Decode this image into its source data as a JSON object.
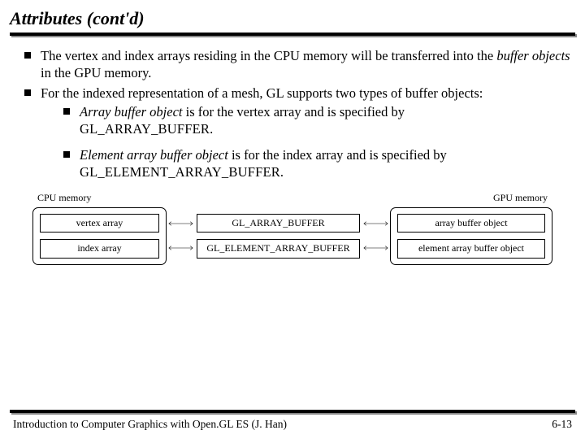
{
  "title": "Attributes (cont'd)",
  "bullets": {
    "b1_pre": "The vertex and index arrays residing in the CPU memory will be transferred into the ",
    "b1_ital": "buffer objects",
    "b1_post": " in the GPU memory.",
    "b2": "For the indexed representation of a mesh, GL supports two types of buffer objects:",
    "s1_ital": "Array buffer object",
    "s1_rest": " is for the vertex array and is specified by ",
    "s1_code": "GL_ARRAY_BUFFER.",
    "s2_ital": "Element array buffer object",
    "s2_rest": " is for the index array and is specified by ",
    "s2_code": "GL_ELEMENT_ARRAY_BUFFER."
  },
  "diagram": {
    "cpu_label": "CPU memory",
    "gpu_label": "GPU memory",
    "cpu_box1": "vertex array",
    "cpu_box2": "index array",
    "mid_box1": "GL_ARRAY_BUFFER",
    "mid_box2": "GL_ELEMENT_ARRAY_BUFFER",
    "gpu_box1": "array buffer object",
    "gpu_box2": "element array buffer object"
  },
  "footer": {
    "left": "Introduction to Computer Graphics with Open.GL ES (J. Han)",
    "right": "6-13"
  }
}
